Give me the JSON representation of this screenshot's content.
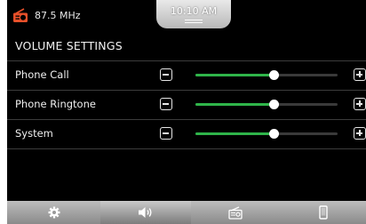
{
  "status_bar": {
    "source_icon": "radio-icon",
    "frequency": "87.5 MHz",
    "time": "10:10 AM"
  },
  "page_title": "VOLUME SETTINGS",
  "volume_rows": [
    {
      "label": "Phone Call",
      "level": 0.55
    },
    {
      "label": "Phone Ringtone",
      "level": 0.55
    },
    {
      "label": "System",
      "level": 0.55
    }
  ],
  "bottom_nav": {
    "tabs": [
      {
        "icon": "gear-icon",
        "active": false
      },
      {
        "icon": "speaker-icon",
        "active": true
      },
      {
        "icon": "radio-icon",
        "active": false
      },
      {
        "icon": "phone-icon",
        "active": false
      }
    ]
  },
  "colors": {
    "accent": "#2fb54a",
    "radio_icon": "#e8502a",
    "background": "#000000"
  }
}
